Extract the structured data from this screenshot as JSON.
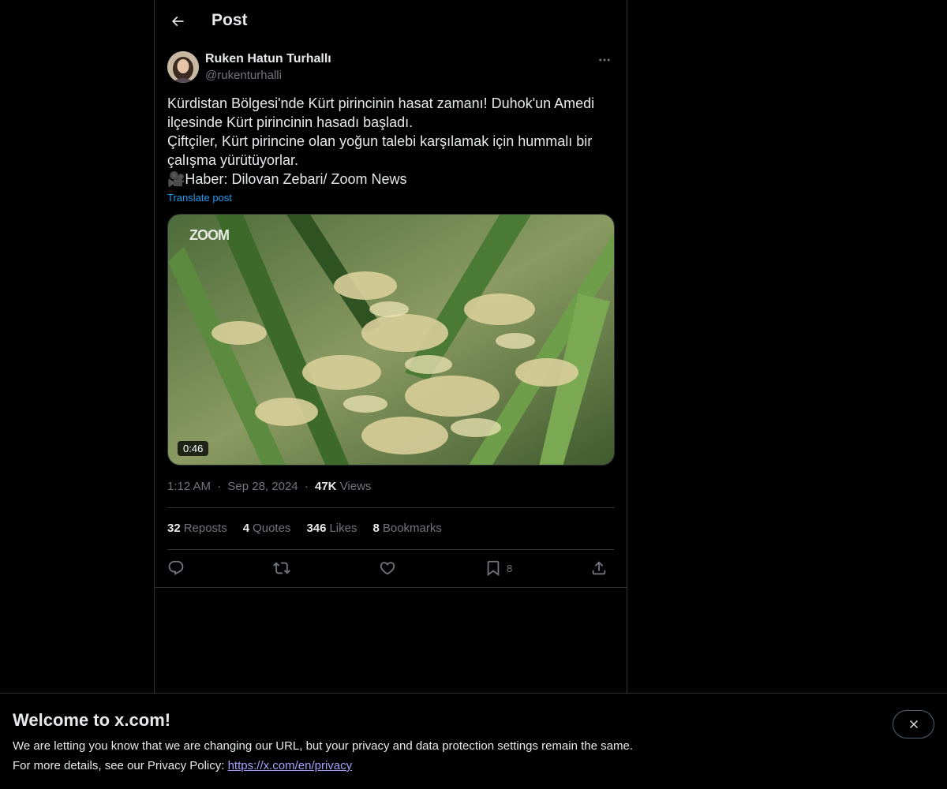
{
  "header": {
    "title": "Post"
  },
  "author": {
    "display_name": "Ruken Hatun Turhallı",
    "handle": "@rukenturhalli"
  },
  "post": {
    "text": "Kürdistan Bölgesi'nde Kürt pirincinin hasat zamanı! Duhok'un Amedi ilçesinde Kürt pirincinin hasadı başladı.\n Çiftçiler, Kürt pirincine olan yoğun talebi karşılamak için hummalı bir çalışma yürütüyorlar.\n🎥Haber: Dilovan Zebari/ Zoom News",
    "translate_label": "Translate post",
    "video_duration": "0:46",
    "watermark": "ZOOM"
  },
  "meta": {
    "time": "1:12 AM",
    "date": "Sep 28, 2024",
    "views_count": "47K",
    "views_label": "Views",
    "separator": "·"
  },
  "stats": [
    {
      "count": "32",
      "label": "Reposts"
    },
    {
      "count": "4",
      "label": "Quotes"
    },
    {
      "count": "346",
      "label": "Likes"
    },
    {
      "count": "8",
      "label": "Bookmarks"
    }
  ],
  "actions": {
    "bookmark_count": "8"
  },
  "icons": [
    "back-arrow-icon",
    "more-icon",
    "reply-icon",
    "repost-icon",
    "like-icon",
    "bookmark-icon",
    "share-icon",
    "close-icon"
  ],
  "banner": {
    "title": "Welcome to x.com!",
    "line1": "We are letting you know that we are changing our URL, but your privacy and data protection settings remain the same.",
    "line2_prefix": "For more details, see our Privacy Policy: ",
    "link": "https://x.com/en/privacy"
  },
  "colors": {
    "background": "#000000",
    "text": "#e7e9ea",
    "muted": "#71767b",
    "accent": "#1d9bf0",
    "border": "#2f3336",
    "link": "#a8a0ff"
  }
}
